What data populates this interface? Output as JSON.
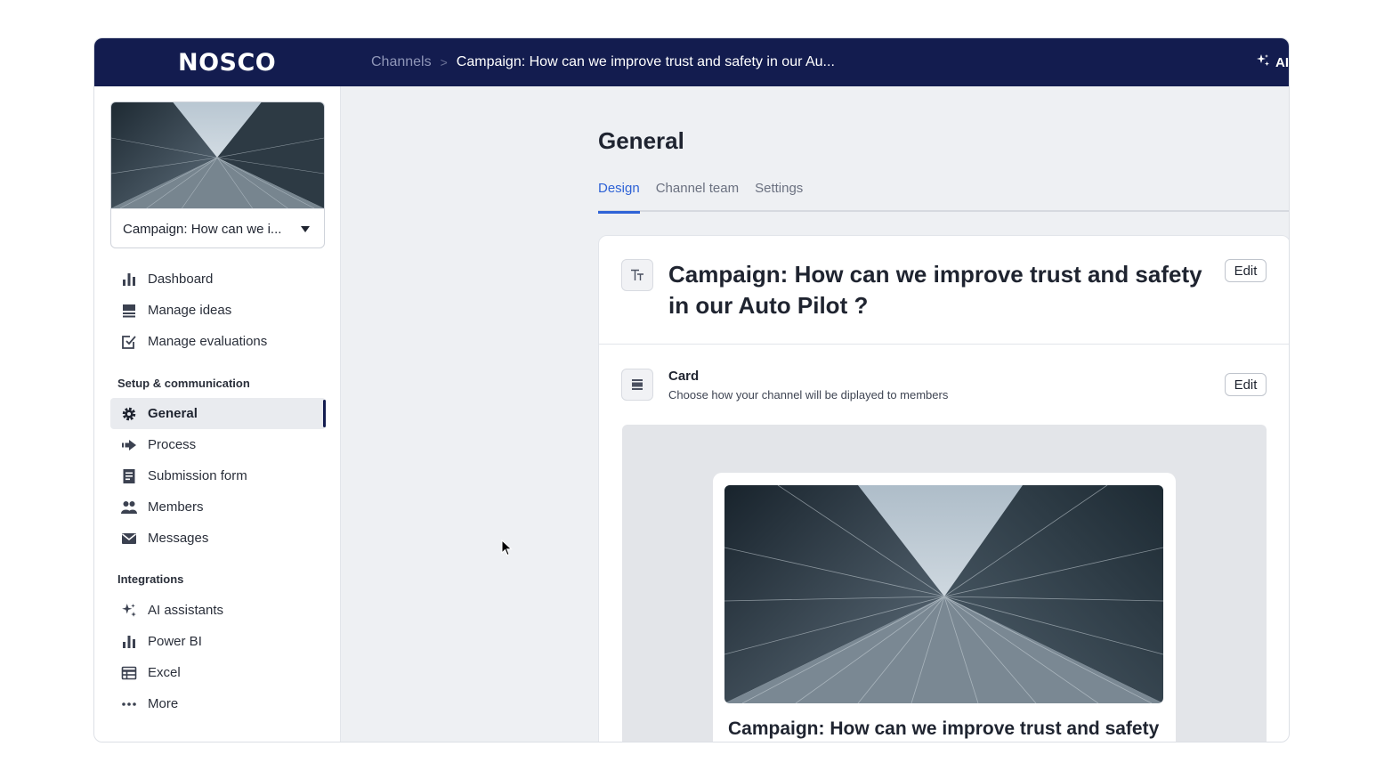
{
  "app": {
    "logo": "NOSCO",
    "breadcrumb": {
      "link": "Channels",
      "separator": ">",
      "current": "Campaign: How can we improve trust and safety in our Au..."
    },
    "ai_label": "AI"
  },
  "sidebar": {
    "channel_select_label": "Campaign: How can we i...",
    "main_items": [
      {
        "label": "Dashboard",
        "icon": "bar-chart-icon"
      },
      {
        "label": "Manage ideas",
        "icon": "list-icon"
      },
      {
        "label": "Manage evaluations",
        "icon": "checkbox-icon"
      }
    ],
    "setup_label": "Setup & communication",
    "setup_items": [
      {
        "label": "General",
        "icon": "gear-icon",
        "active": true
      },
      {
        "label": "Process",
        "icon": "arrow-right-icon"
      },
      {
        "label": "Submission form",
        "icon": "form-icon"
      },
      {
        "label": "Members",
        "icon": "users-icon"
      },
      {
        "label": "Messages",
        "icon": "envelope-icon"
      }
    ],
    "integrations_label": "Integrations",
    "integration_items": [
      {
        "label": "AI assistants",
        "icon": "sparkle-icon"
      },
      {
        "label": "Power BI",
        "icon": "bar-chart-icon"
      },
      {
        "label": "Excel",
        "icon": "table-icon"
      },
      {
        "label": "More",
        "icon": "more-dots-icon"
      }
    ]
  },
  "main": {
    "page_title": "General",
    "tabs": [
      {
        "label": "Design",
        "active": true
      },
      {
        "label": "Channel team"
      },
      {
        "label": "Settings"
      }
    ],
    "title_section": {
      "heading": "Campaign: How can we improve trust and safety in our Auto Pilot ?",
      "edit_label": "Edit"
    },
    "card_section": {
      "title": "Card",
      "description": "Choose how your channel will be diplayed to members",
      "edit_label": "Edit"
    },
    "preview": {
      "title": "Campaign: How can we improve trust and safety"
    }
  },
  "colors": {
    "topbar": "#131c4f",
    "accent": "#2f63d6"
  }
}
